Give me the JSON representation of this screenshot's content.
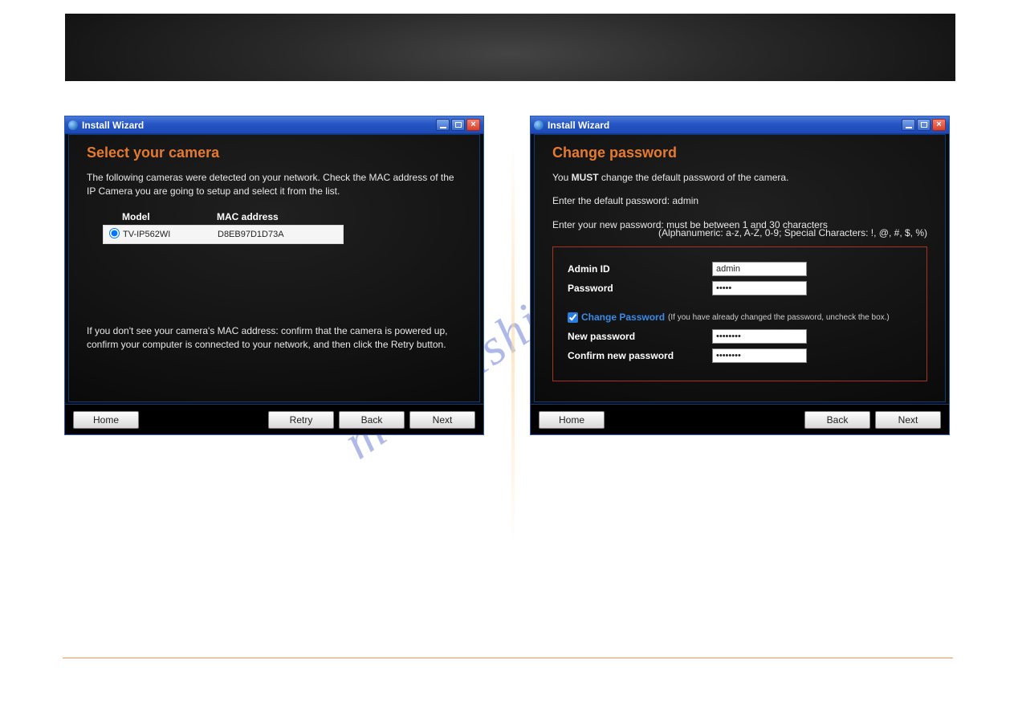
{
  "watermark": "manualshive.com",
  "window_title": "Install Wizard",
  "left": {
    "heading": "Select your camera",
    "intro": "The following cameras were detected on your network. Check the MAC address of the IP Camera you are going to setup and select it from the list.",
    "col_model": "Model",
    "col_mac": "MAC address",
    "row_model": "TV-IP562WI",
    "row_mac": "D8EB97D1D73A",
    "note": "If you don't see your camera's MAC address: confirm that the camera is powered up, confirm your computer is connected to your network, and then click the Retry button.",
    "btn_home": "Home",
    "btn_retry": "Retry",
    "btn_back": "Back",
    "btn_next": "Next"
  },
  "right": {
    "heading": "Change password",
    "line1_a": "You ",
    "line1_b": "MUST",
    "line1_c": " change the default password of the camera.",
    "line2": "Enter the default password: admin",
    "line3": "Enter your new password: must be between 1 and 30 characters",
    "hint": "(Alphanumeric: a-z, A-Z, 0-9; Special Characters: !, @, #, $, %)",
    "label_admin": "Admin ID",
    "val_admin": "admin",
    "label_pw": "Password",
    "val_pw": "•••••",
    "chk_label": "Change Password",
    "chk_note": "(If you have already changed the password, uncheck the box.)",
    "label_new": "New password",
    "val_new": "••••••••",
    "label_conf": "Confirm new password",
    "val_conf": "••••••••",
    "btn_home": "Home",
    "btn_back": "Back",
    "btn_next": "Next"
  }
}
